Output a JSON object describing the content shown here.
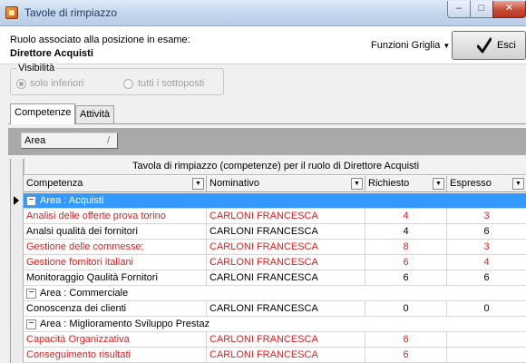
{
  "window": {
    "title": "Tavole di rimpiazzo",
    "min_glyph": "–",
    "max_glyph": "□",
    "close_glyph": "✕"
  },
  "header": {
    "role_caption": "Ruolo associato alla posizione in esame:",
    "role_name": "Direttore Acquisti",
    "grid_functions_label": "Funzioni Griglia",
    "grid_functions_caret": "▼",
    "exit_label": "Esci"
  },
  "visibility": {
    "legend": "Visibilità",
    "options": [
      {
        "label": "solo inferiori",
        "checked": true
      },
      {
        "label": "tutti i sottoposti",
        "checked": false
      }
    ]
  },
  "tabs": [
    {
      "label": "Competenze",
      "active": true
    },
    {
      "label": "Attività",
      "active": false
    }
  ],
  "grid": {
    "group_by_chip": "Area",
    "group_by_sort_glyph": "/",
    "title": "Tavola di rimpiazzo (competenze) per il ruolo di Direttore Acquisti",
    "columns": [
      "Competenza",
      "Nominativo",
      "Richiesto",
      "Espresso"
    ],
    "expander_glyph": "−",
    "rows": [
      {
        "kind": "group",
        "label": "Area : Acquisti",
        "selected": true
      },
      {
        "kind": "data",
        "competenza": "Analisi delle offerte prova torino",
        "nominativo": "CARLONI FRANCESCA",
        "richiesto": "4",
        "espresso": "3",
        "red": true
      },
      {
        "kind": "data",
        "competenza": "Analsi qualità dei fornitori",
        "nominativo": "CARLONI FRANCESCA",
        "richiesto": "4",
        "espresso": "6",
        "red": false
      },
      {
        "kind": "data",
        "competenza": "Gestione delle commesse;",
        "nominativo": "CARLONI FRANCESCA",
        "richiesto": "8",
        "espresso": "3",
        "red": true
      },
      {
        "kind": "data",
        "competenza": "Gestione fornitori italiani",
        "nominativo": "CARLONI FRANCESCA",
        "richiesto": "6",
        "espresso": "4",
        "red": true
      },
      {
        "kind": "data",
        "competenza": "Monitoraggio Qaulità Fornitori",
        "nominativo": "CARLONI FRANCESCA",
        "richiesto": "6",
        "espresso": "6",
        "red": false
      },
      {
        "kind": "group",
        "label": "Area : Commerciale",
        "selected": false
      },
      {
        "kind": "data",
        "competenza": "Conoscenza dei clienti",
        "nominativo": "CARLONI FRANCESCA",
        "richiesto": "0",
        "espresso": "0",
        "red": false
      },
      {
        "kind": "group",
        "label": "Area : Miglioramento Sviluppo Prestaz",
        "selected": false
      },
      {
        "kind": "data",
        "competenza": "Capacità Organizzativa",
        "nominativo": "CARLONI FRANCESCA",
        "richiesto": "6",
        "espresso": "",
        "red": true
      },
      {
        "kind": "data",
        "competenza": "Conseguimento risultati",
        "nominativo": "CARLONI FRANCESCA",
        "richiesto": "6",
        "espresso": "",
        "red": true
      }
    ]
  },
  "colors": {
    "selection": "#3399ff",
    "below_requirement_text": "#e0201f"
  }
}
